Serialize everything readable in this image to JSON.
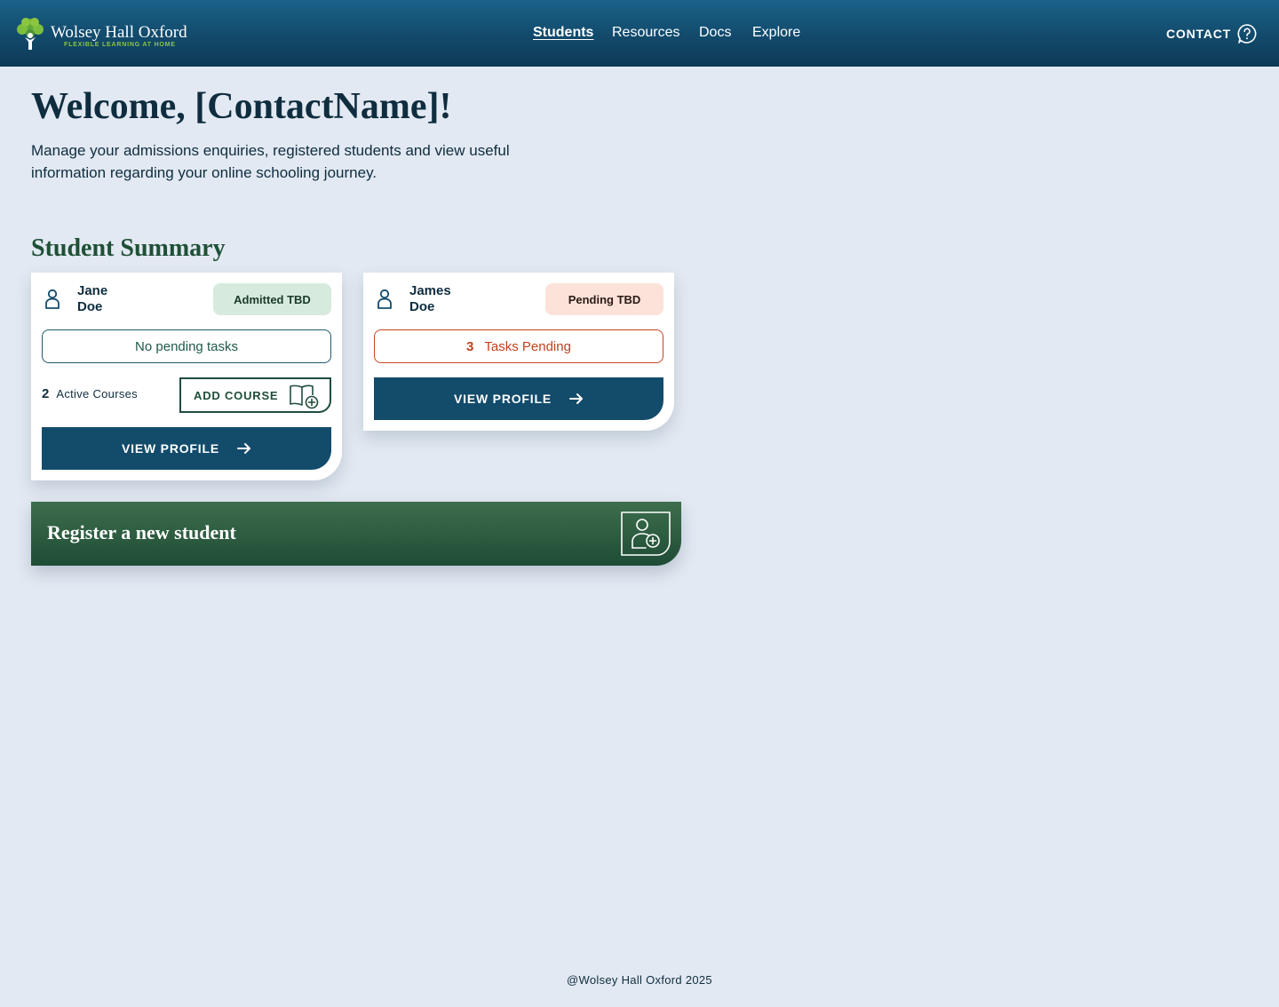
{
  "header": {
    "logo_name": "Wolsey Hall Oxford",
    "logo_tagline": "FLEXIBLE LEARNING AT HOME",
    "nav": [
      {
        "label": "Students",
        "active": true
      },
      {
        "label": "Resources",
        "active": false
      },
      {
        "label": "Docs",
        "active": false
      },
      {
        "label": "Explore",
        "active": false
      }
    ],
    "contact_label": "CONTACT",
    "contact_icon": "help-icon"
  },
  "welcome": {
    "title": "Welcome, [ContactName]!",
    "subtitle": "Manage your admissions enquiries, registered students and view useful information regarding your online schooling journey."
  },
  "summary": {
    "title": "Student Summary",
    "students": [
      {
        "name_first": "Jane",
        "name_last": "Doe",
        "status": "Admitted TBD",
        "tasks_text": "No pending tasks",
        "active_courses_count": "2",
        "active_courses_label": "Active Courses",
        "add_course_label": "ADD COURSE",
        "view_profile_label": "VIEW PROFILE"
      },
      {
        "name_first": "James",
        "name_last": "Doe",
        "status": "Pending TBD",
        "tasks_count": "3",
        "tasks_label": "Tasks Pending",
        "view_profile_label": "VIEW PROFILE"
      }
    ]
  },
  "register": {
    "label": "Register a new student",
    "icon": "add-user-icon"
  },
  "footer": {
    "copyright": "@Wolsey Hall Oxford 2025"
  },
  "colors": {
    "header_blue": "#134b6b",
    "page_bg": "#e2e9f2",
    "green": "#1f4d3a",
    "admitted_badge": "#d6ebdd",
    "pending_badge": "#fde2da",
    "pending_orange": "#c8461f"
  }
}
